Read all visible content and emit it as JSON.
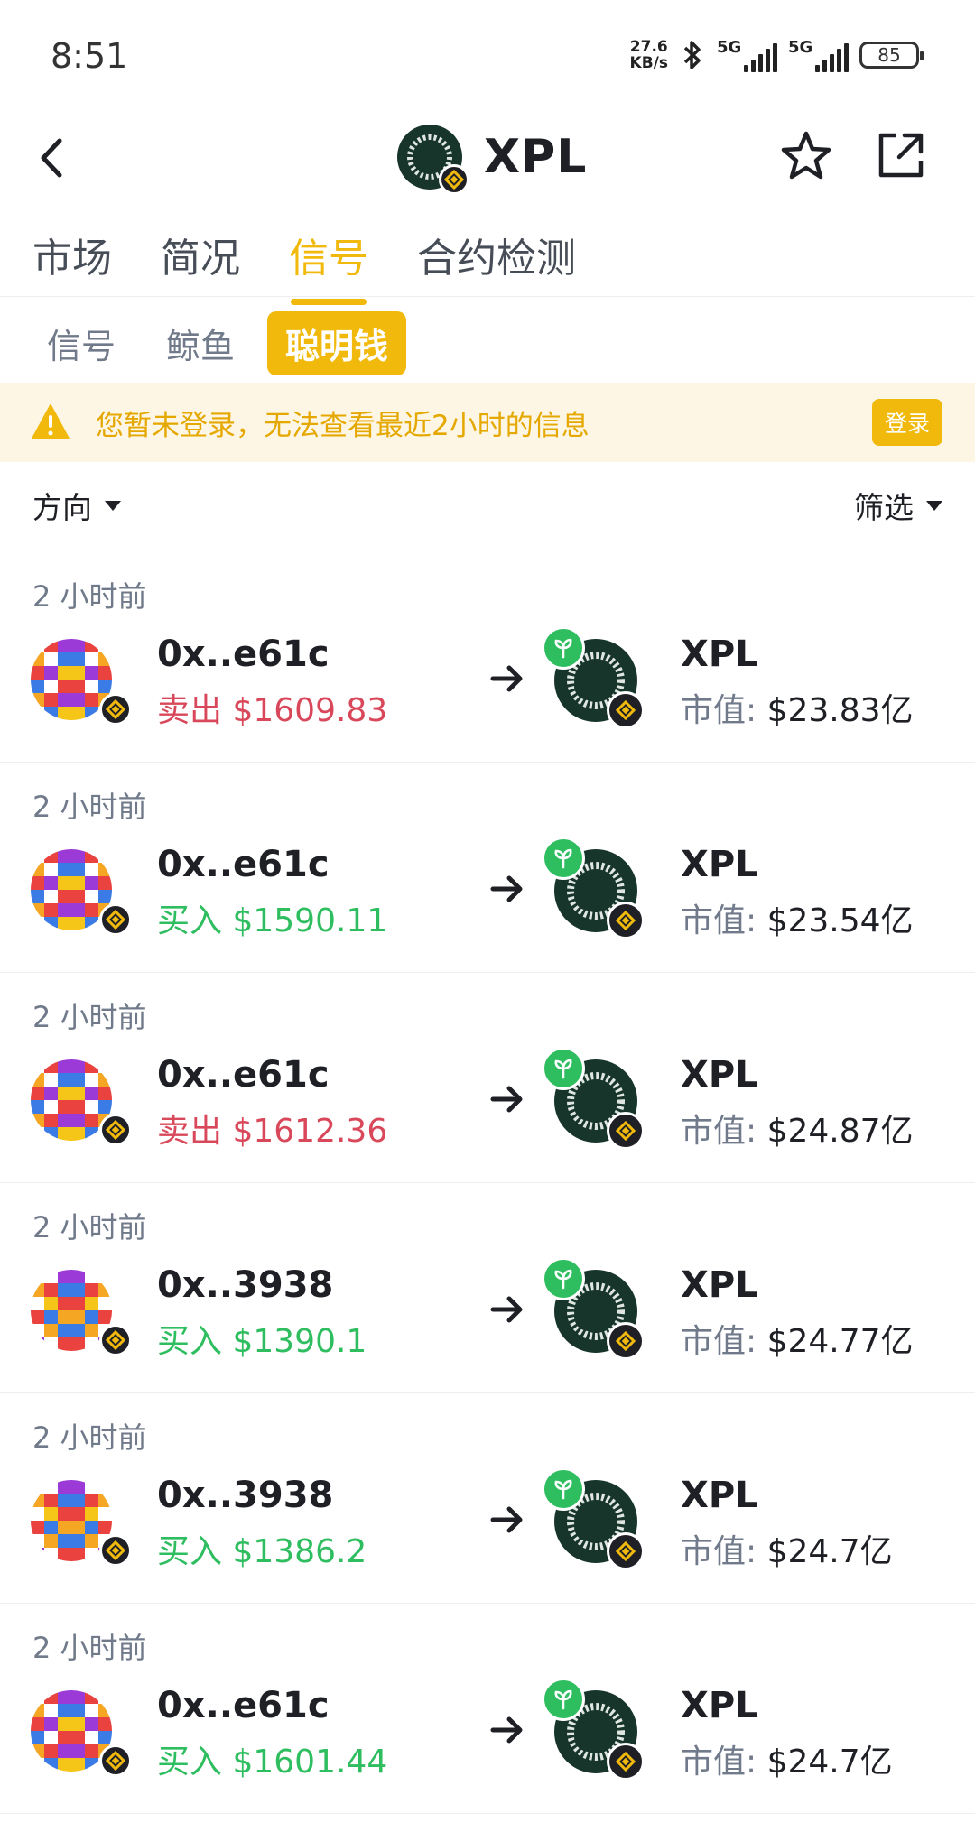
{
  "status_bar": {
    "time": "8:51",
    "net_speed_top": "27.6",
    "net_speed_bottom": "KB/s",
    "signal_1_label": "5G",
    "signal_2_label": "5G",
    "battery": "85"
  },
  "header": {
    "title": "XPL"
  },
  "tabs": [
    {
      "label": "市场",
      "active": false
    },
    {
      "label": "简况",
      "active": false
    },
    {
      "label": "信号",
      "active": true
    },
    {
      "label": "合约检测",
      "active": false
    }
  ],
  "subtabs": [
    {
      "label": "信号",
      "active": false
    },
    {
      "label": "鲸鱼",
      "active": false
    },
    {
      "label": "聪明钱",
      "active": true
    }
  ],
  "banner": {
    "text": "您暂未登录，无法查看最近2小时的信息",
    "login_label": "登录"
  },
  "filters": {
    "direction_label": "方向",
    "filter_label": "筛选"
  },
  "colors": {
    "accent": "#f0b90b",
    "sell": "#d9485a",
    "buy": "#2ebd5f",
    "token_bg": "#17352b"
  },
  "trades": [
    {
      "time": "2 小时前",
      "address": "0x..e61c",
      "action": "卖出",
      "side": "sell",
      "amount": "$1609.83",
      "symbol": "XPL",
      "mcap_label": "市值:",
      "mcap_value": "$23.83亿",
      "avatar": "a"
    },
    {
      "time": "2 小时前",
      "address": "0x..e61c",
      "action": "买入",
      "side": "buy",
      "amount": "$1590.11",
      "symbol": "XPL",
      "mcap_label": "市值:",
      "mcap_value": "$23.54亿",
      "avatar": "a"
    },
    {
      "time": "2 小时前",
      "address": "0x..e61c",
      "action": "卖出",
      "side": "sell",
      "amount": "$1612.36",
      "symbol": "XPL",
      "mcap_label": "市值:",
      "mcap_value": "$24.87亿",
      "avatar": "a"
    },
    {
      "time": "2 小时前",
      "address": "0x..3938",
      "action": "买入",
      "side": "buy",
      "amount": "$1390.1",
      "symbol": "XPL",
      "mcap_label": "市值:",
      "mcap_value": "$24.77亿",
      "avatar": "b"
    },
    {
      "time": "2 小时前",
      "address": "0x..3938",
      "action": "买入",
      "side": "buy",
      "amount": "$1386.2",
      "symbol": "XPL",
      "mcap_label": "市值:",
      "mcap_value": "$24.7亿",
      "avatar": "b"
    },
    {
      "time": "2 小时前",
      "address": "0x..e61c",
      "action": "买入",
      "side": "buy",
      "amount": "$1601.44",
      "symbol": "XPL",
      "mcap_label": "市值:",
      "mcap_value": "$24.7亿",
      "avatar": "a"
    }
  ]
}
